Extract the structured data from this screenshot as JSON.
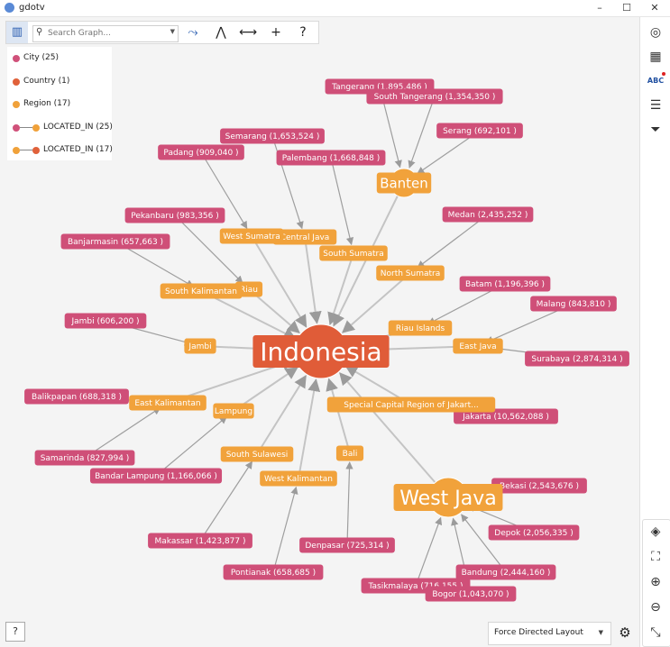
{
  "window": {
    "title": "gdotv",
    "minimize": "–",
    "maximize": "☐",
    "close": "✕"
  },
  "toolbar": {
    "search_placeholder": "Search Graph...",
    "buttons": [
      {
        "name": "path-icon",
        "glyph": "⤳"
      },
      {
        "name": "hierarchy-icon",
        "glyph": "⋀"
      },
      {
        "name": "expand-horizontal-icon",
        "glyph": "⟷"
      },
      {
        "name": "add-icon",
        "glyph": "+"
      },
      {
        "name": "help-icon",
        "glyph": "?"
      }
    ]
  },
  "legend": {
    "items": [
      {
        "label": "City (25)",
        "color": "#d0517a",
        "type": "node"
      },
      {
        "label": "Country (1)",
        "color": "#e0613a",
        "type": "node"
      },
      {
        "label": "Region (17)",
        "color": "#f0a13a",
        "type": "node"
      },
      {
        "label": "LOCATED_IN (25)",
        "from": "#d0517a",
        "to": "#f0a13a",
        "type": "edge"
      },
      {
        "label": "LOCATED_IN (17)",
        "from": "#f0a13a",
        "to": "#e0613a",
        "type": "edge"
      }
    ]
  },
  "colors": {
    "city": "#cf4f78",
    "country": "#e05c38",
    "region": "#f1a23b",
    "edge": "#b8b8b8",
    "arrow": "#999999"
  },
  "graph": {
    "country": {
      "id": "indonesia",
      "label": "Indonesia"
    },
    "regions": [
      {
        "id": "banten",
        "label": "Banten",
        "size": "lg"
      },
      {
        "id": "westjava",
        "label": "West Java",
        "size": "xl"
      },
      {
        "id": "centraljava",
        "label": "Central Java"
      },
      {
        "id": "westsumatra",
        "label": "West Sumatra"
      },
      {
        "id": "southsumatra",
        "label": "South Sumatra"
      },
      {
        "id": "northsumatra",
        "label": "North Sumatra"
      },
      {
        "id": "riau",
        "label": "Riau"
      },
      {
        "id": "southkal",
        "label": "South Kalimantan"
      },
      {
        "id": "jambi",
        "label": "Jambi"
      },
      {
        "id": "riauislands",
        "label": "Riau Islands"
      },
      {
        "id": "eastjava",
        "label": "East Java"
      },
      {
        "id": "eastkal",
        "label": "East Kalimantan"
      },
      {
        "id": "lampung",
        "label": "Lampung"
      },
      {
        "id": "jakarta_r",
        "label": "Special Capital Region of Jakart..."
      },
      {
        "id": "southsul",
        "label": "South Sulawesi"
      },
      {
        "id": "bali",
        "label": "Bali"
      },
      {
        "id": "westkal",
        "label": "West Kalimantan"
      }
    ],
    "cities": [
      {
        "id": "tangerang",
        "label": "Tangerang (1,895,486 )",
        "region": "banten"
      },
      {
        "id": "southtangerang",
        "label": "South Tangerang (1,354,350 )",
        "region": "banten"
      },
      {
        "id": "serang",
        "label": "Serang (692,101 )",
        "region": "banten"
      },
      {
        "id": "semarang",
        "label": "Semarang (1,653,524 )",
        "region": "centraljava"
      },
      {
        "id": "padang",
        "label": "Padang (909,040 )",
        "region": "westsumatra"
      },
      {
        "id": "palembang",
        "label": "Palembang (1,668,848 )",
        "region": "southsumatra"
      },
      {
        "id": "medan",
        "label": "Medan (2,435,252 )",
        "region": "northsumatra"
      },
      {
        "id": "pekanbaru",
        "label": "Pekanbaru (983,356 )",
        "region": "riau"
      },
      {
        "id": "banjarmasin",
        "label": "Banjarmasin (657,663 )",
        "region": "southkal"
      },
      {
        "id": "batam",
        "label": "Batam (1,196,396 )",
        "region": "riauislands"
      },
      {
        "id": "malang",
        "label": "Malang (843,810 )",
        "region": "eastjava"
      },
      {
        "id": "jambi_c",
        "label": "Jambi (606,200 )",
        "region": "jambi"
      },
      {
        "id": "surabaya",
        "label": "Surabaya (2,874,314 )",
        "region": "eastjava"
      },
      {
        "id": "balikpapan",
        "label": "Balikpapan (688,318 )",
        "region": "eastkal"
      },
      {
        "id": "jakarta_c",
        "label": "Jakarta (10,562,088 )",
        "region": "jakarta_r"
      },
      {
        "id": "samarinda",
        "label": "Samarinda (827,994 )",
        "region": "eastkal"
      },
      {
        "id": "bandarlampung",
        "label": "Bandar Lampung (1,166,066 )",
        "region": "lampung"
      },
      {
        "id": "bekasi",
        "label": "Bekasi (2,543,676 )",
        "region": "westjava"
      },
      {
        "id": "depok",
        "label": "Depok (2,056,335 )",
        "region": "westjava"
      },
      {
        "id": "makassar",
        "label": "Makassar (1,423,877 )",
        "region": "southsul"
      },
      {
        "id": "denpasar",
        "label": "Denpasar (725,314 )",
        "region": "bali"
      },
      {
        "id": "pontianak",
        "label": "Pontianak (658,685 )",
        "region": "westkal"
      },
      {
        "id": "bandung",
        "label": "Bandung (2,444,160 )",
        "region": "westjava"
      },
      {
        "id": "tasikmalaya",
        "label": "Tasikmalaya (716,155 )",
        "region": "westjava"
      },
      {
        "id": "bogor",
        "label": "Bogor (1,043,070 )",
        "region": "westjava"
      }
    ]
  },
  "bottom": {
    "layout_label": "Force Directed Layout",
    "help_glyph": "?"
  },
  "rightbar": {
    "top": [
      {
        "name": "locate-icon",
        "glyph": "◎"
      },
      {
        "name": "table-icon",
        "glyph": "▦"
      },
      {
        "name": "text-label-icon",
        "glyph": "ABC"
      },
      {
        "name": "sliders-icon",
        "glyph": "☰"
      },
      {
        "name": "filter-icon",
        "glyph": "⏷"
      }
    ],
    "bottom": [
      {
        "name": "layers-icon",
        "glyph": "◈"
      },
      {
        "name": "fit-screen-icon",
        "glyph": "⛶"
      },
      {
        "name": "zoom-in-icon",
        "glyph": "⊕"
      },
      {
        "name": "zoom-out-icon",
        "glyph": "⊖"
      },
      {
        "name": "collapse-icon",
        "glyph": "⤡"
      }
    ]
  }
}
